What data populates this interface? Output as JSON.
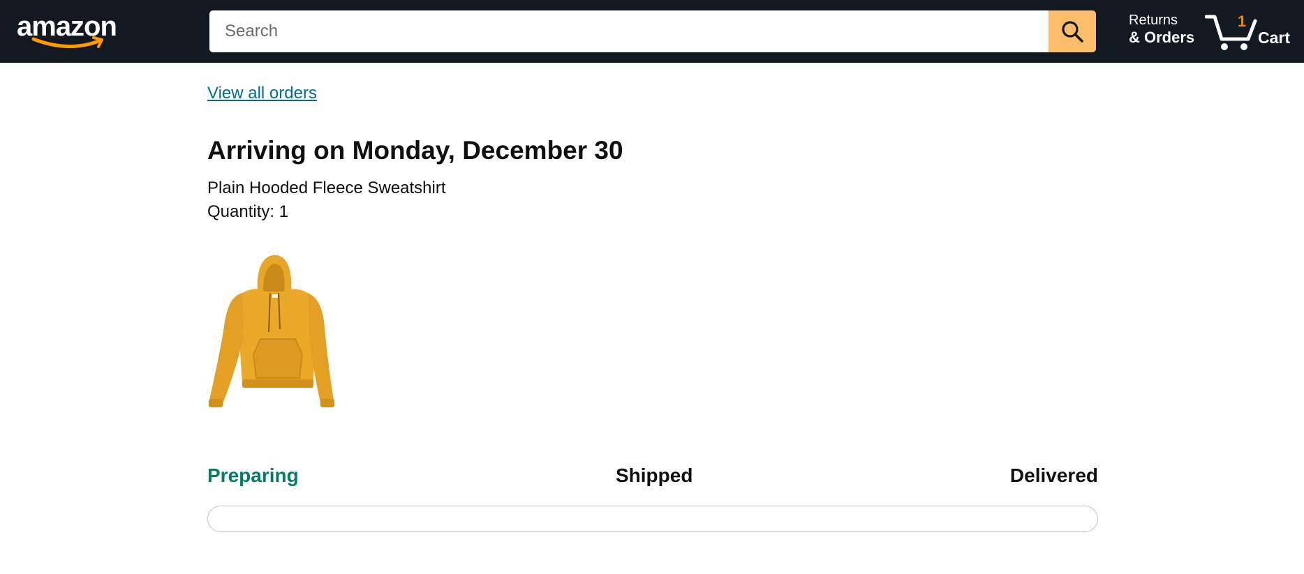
{
  "header": {
    "logo_text": "amazon",
    "logo_smile_color": "#ff9900",
    "search": {
      "placeholder": "Search",
      "value": "",
      "button_icon": "search-icon"
    },
    "returns": {
      "line1": "Returns",
      "line2": "& Orders"
    },
    "cart": {
      "icon": "cart-icon",
      "count": "1",
      "label": "Cart"
    }
  },
  "order": {
    "view_all_label": "View all orders",
    "arriving_title": "Arriving on Monday, December 30",
    "product_name": "Plain Hooded Fleece Sweatshirt",
    "quantity_label": "Quantity: 1",
    "product_image_alt": "product-image-hoodie"
  },
  "tracking": {
    "steps": [
      {
        "label": "Preparing",
        "active": true
      },
      {
        "label": "Shipped",
        "active": false
      },
      {
        "label": "Delivered",
        "active": false
      }
    ],
    "progress_fraction": 0
  },
  "colors": {
    "header_bg": "#131921",
    "search_button": "#febd69",
    "link": "#007185",
    "active_step": "#067d62",
    "cart_count": "#f08804",
    "product": "#e8a628"
  }
}
